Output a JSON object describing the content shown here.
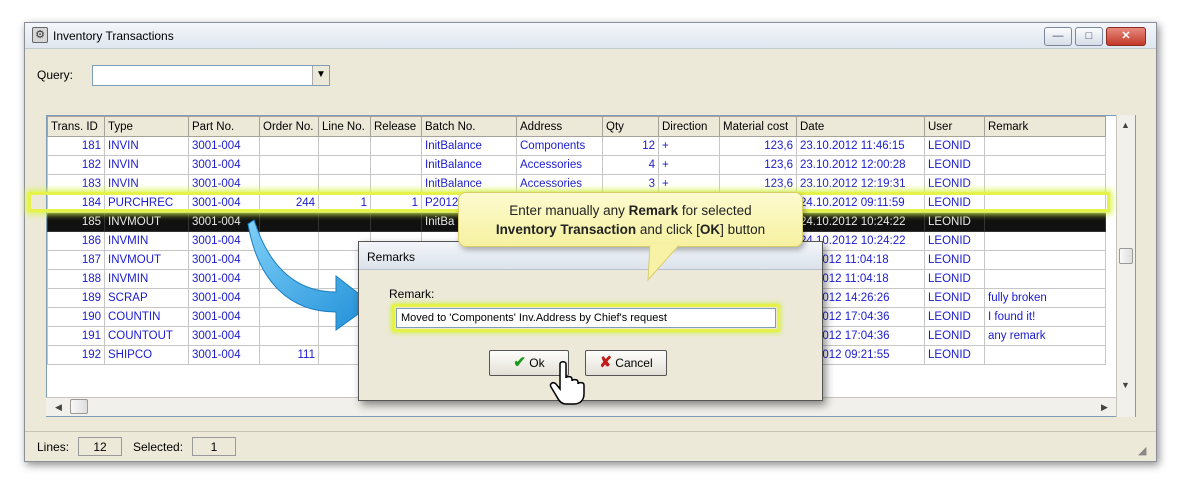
{
  "window": {
    "title": "Inventory Transactions",
    "controls": {
      "minimize": "—",
      "maximize": "□",
      "close": "✕"
    }
  },
  "query": {
    "label": "Query:",
    "value": ""
  },
  "grid": {
    "columns": [
      "Trans. ID",
      "Type",
      "Part No.",
      "Order No.",
      "Line No.",
      "Release",
      "Batch No.",
      "Address",
      "Qty",
      "Direction",
      "Material cost",
      "Date",
      "User",
      "Remark"
    ],
    "rows": [
      [
        "181",
        "INVIN",
        "3001-004",
        "",
        "",
        "",
        "InitBalance",
        "Components",
        "12",
        "+",
        "123,6",
        "23.10.2012 11:46:15",
        "LEONID",
        ""
      ],
      [
        "182",
        "INVIN",
        "3001-004",
        "",
        "",
        "",
        "InitBalance",
        "Accessories",
        "4",
        "+",
        "123,6",
        "23.10.2012 12:00:28",
        "LEONID",
        ""
      ],
      [
        "183",
        "INVIN",
        "3001-004",
        "",
        "",
        "",
        "InitBalance",
        "Accessories",
        "3",
        "+",
        "123,6",
        "23.10.2012 12:19:31",
        "LEONID",
        ""
      ],
      [
        "184",
        "PURCHREC",
        "3001-004",
        "244",
        "1",
        "1",
        "P2012",
        "",
        "",
        "",
        "",
        "24.10.2012 09:11:59",
        "LEONID",
        ""
      ],
      [
        "185",
        "INVMOUT",
        "3001-004",
        "",
        "",
        "",
        "InitBa",
        "",
        "",
        "",
        "",
        "24.10.2012 10:24:22",
        "LEONID",
        ""
      ],
      [
        "186",
        "INVMIN",
        "3001-004",
        "",
        "",
        "",
        "",
        "",
        "",
        "",
        "",
        "24.10.2012 10:24:22",
        "LEONID",
        ""
      ],
      [
        "187",
        "INVMOUT",
        "3001-004",
        "",
        "",
        "",
        "",
        "",
        "",
        "",
        "",
        "10.2012 11:04:18",
        "LEONID",
        ""
      ],
      [
        "188",
        "INVMIN",
        "3001-004",
        "",
        "",
        "",
        "",
        "",
        "",
        "",
        "",
        "10.2012 11:04:18",
        "LEONID",
        ""
      ],
      [
        "189",
        "SCRAP",
        "3001-004",
        "",
        "",
        "",
        "",
        "",
        "",
        "",
        "",
        "10.2012 14:26:26",
        "LEONID",
        "fully broken"
      ],
      [
        "190",
        "COUNTIN",
        "3001-004",
        "",
        "",
        "",
        "",
        "",
        "",
        "",
        "",
        "10.2012 17:04:36",
        "LEONID",
        "I found it!"
      ],
      [
        "191",
        "COUNTOUT",
        "3001-004",
        "",
        "",
        "",
        "",
        "",
        "",
        "",
        "",
        "10.2012 17:04:36",
        "LEONID",
        "any remark"
      ],
      [
        "192",
        "SHIPCO",
        "3001-004",
        "111",
        "",
        "",
        "",
        "",
        "",
        "",
        "",
        "10.2012 09:21:55",
        "LEONID",
        ""
      ]
    ],
    "selected_row": 4
  },
  "status": {
    "lines_label": "Lines:",
    "lines_value": "12",
    "selected_label": "Selected:",
    "selected_value": "1"
  },
  "dialog": {
    "title": "Remarks",
    "remark_label": "Remark:",
    "remark_value": "Moved to 'Components' Inv.Address by Chief's request",
    "ok_label": "Ok",
    "cancel_label": "Cancel"
  },
  "callout": {
    "part1": "Enter manually any ",
    "bold1": "Remark",
    "part2": " for selected",
    "bold2": "Inventory Transaction",
    "part3": " and click [",
    "bold3": "OK",
    "part4": "] button"
  },
  "colors": {
    "accent_highlight": "#e4f24a",
    "grid_text": "#1b1bcf",
    "selected_row_bg": "#111111",
    "callout_bg": "#f6f1a0",
    "arrow": "#3aa8e6"
  }
}
